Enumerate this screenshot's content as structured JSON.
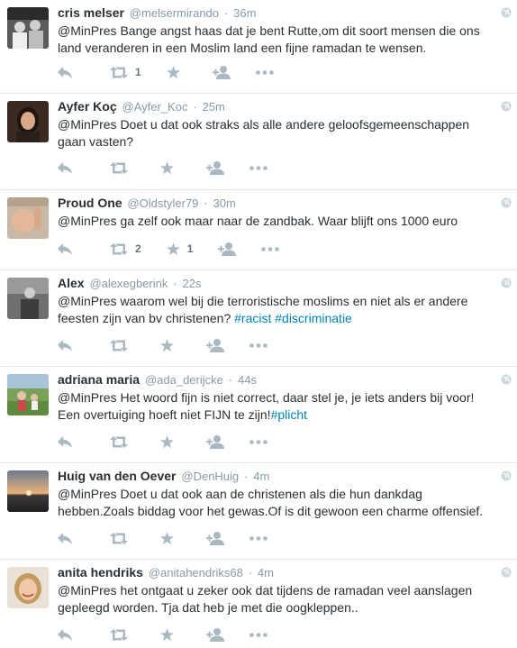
{
  "tweets": [
    {
      "fullname": "cris melser",
      "username": "@melsermirando",
      "time": "36m",
      "text": "@MinPres Bange angst haas dat je bent Rutte,om dit soort mensen die ons land veranderen in een Moslim land een fijne ramadan te wensen.",
      "retweets": "1",
      "favorites": ""
    },
    {
      "fullname": "Ayfer Koç",
      "username": "@Ayfer_Koc",
      "time": "25m",
      "text": "@MinPres Doet u dat ook straks als alle andere geloofsgemeenschappen gaan vasten?",
      "retweets": "",
      "favorites": ""
    },
    {
      "fullname": "Proud One",
      "username": "@Oldstyler79",
      "time": "30m",
      "text": "@MinPres ga zelf ook maar naar de zandbak. Waar blijft ons 1000 euro",
      "retweets": "2",
      "favorites": "1"
    },
    {
      "fullname": "Alex",
      "username": "@alexegberink",
      "time": "22s",
      "text_plain": "@MinPres waarom wel bij die terroristische moslims en niet als er andere feesten zijn van bv christenen? ",
      "hashtags": [
        "#racist",
        "#discriminatie"
      ],
      "retweets": "",
      "favorites": ""
    },
    {
      "fullname": "adriana maria",
      "username": "@ada_derijcke",
      "time": "44s",
      "text_plain": "@MinPres Het woord fijn is niet correct, daar stel je, je iets anders bij voor! Een overtuiging hoeft niet FIJN te zijn!",
      "hashtags": [
        "#plicht"
      ],
      "retweets": "",
      "favorites": ""
    },
    {
      "fullname": "Huig van den Oever",
      "username": "@DenHuig",
      "time": "4m",
      "text": "@MinPres Doet u dat ook aan de christenen als die hun dankdag hebben.Zoals biddag voor het gewas.Of is dit gewoon een charme offensief.",
      "retweets": "",
      "favorites": ""
    },
    {
      "fullname": "anita hendriks",
      "username": "@anitahendriks68",
      "time": "4m",
      "text": "@MinPres het ontgaat u zeker ook dat tijdens de ramadan veel aanslagen gepleegd worden. Tja dat heb je met die oogkleppen..",
      "retweets": "",
      "favorites": ""
    }
  ],
  "icons": {
    "reply": "reply-icon",
    "retweet": "retweet-icon",
    "favorite": "star-icon",
    "follow": "follow-icon",
    "more": "more-icon",
    "globe": "globe-icon"
  },
  "colors": {
    "text": "#292f33",
    "meta": "#8899a6",
    "hashtag": "#0084b4",
    "icon": "#aab8c2",
    "divider": "#e1e8ed"
  }
}
